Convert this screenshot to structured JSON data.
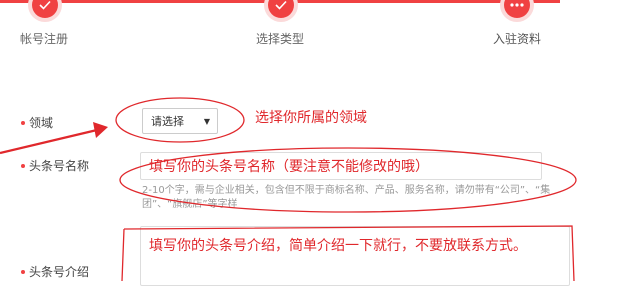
{
  "stepper": {
    "steps": [
      {
        "label": "帐号注册",
        "state": "done"
      },
      {
        "label": "选择类型",
        "state": "done"
      },
      {
        "label": "入驻资料",
        "state": "current"
      }
    ],
    "accent_color": "#f04142"
  },
  "form": {
    "domain": {
      "label": "领域",
      "select_value": "请选择"
    },
    "name": {
      "label": "头条号名称",
      "input_value": "填写你的头条号名称（要注意不能修改的哦）",
      "hint": "2-10个字，需与企业相关，包含但不限于商标名称、产品、服务名称，请勿带有“公司”、“集团”、“旗舰店”等字样"
    },
    "intro": {
      "label": "头条号介绍",
      "textarea_value": "填写你的头条号介绍，简单介绍一下就行，不要放联系方式。"
    }
  },
  "annotations": {
    "domain_note": "选择你所属的领域",
    "markup_color": "#e0282c"
  }
}
